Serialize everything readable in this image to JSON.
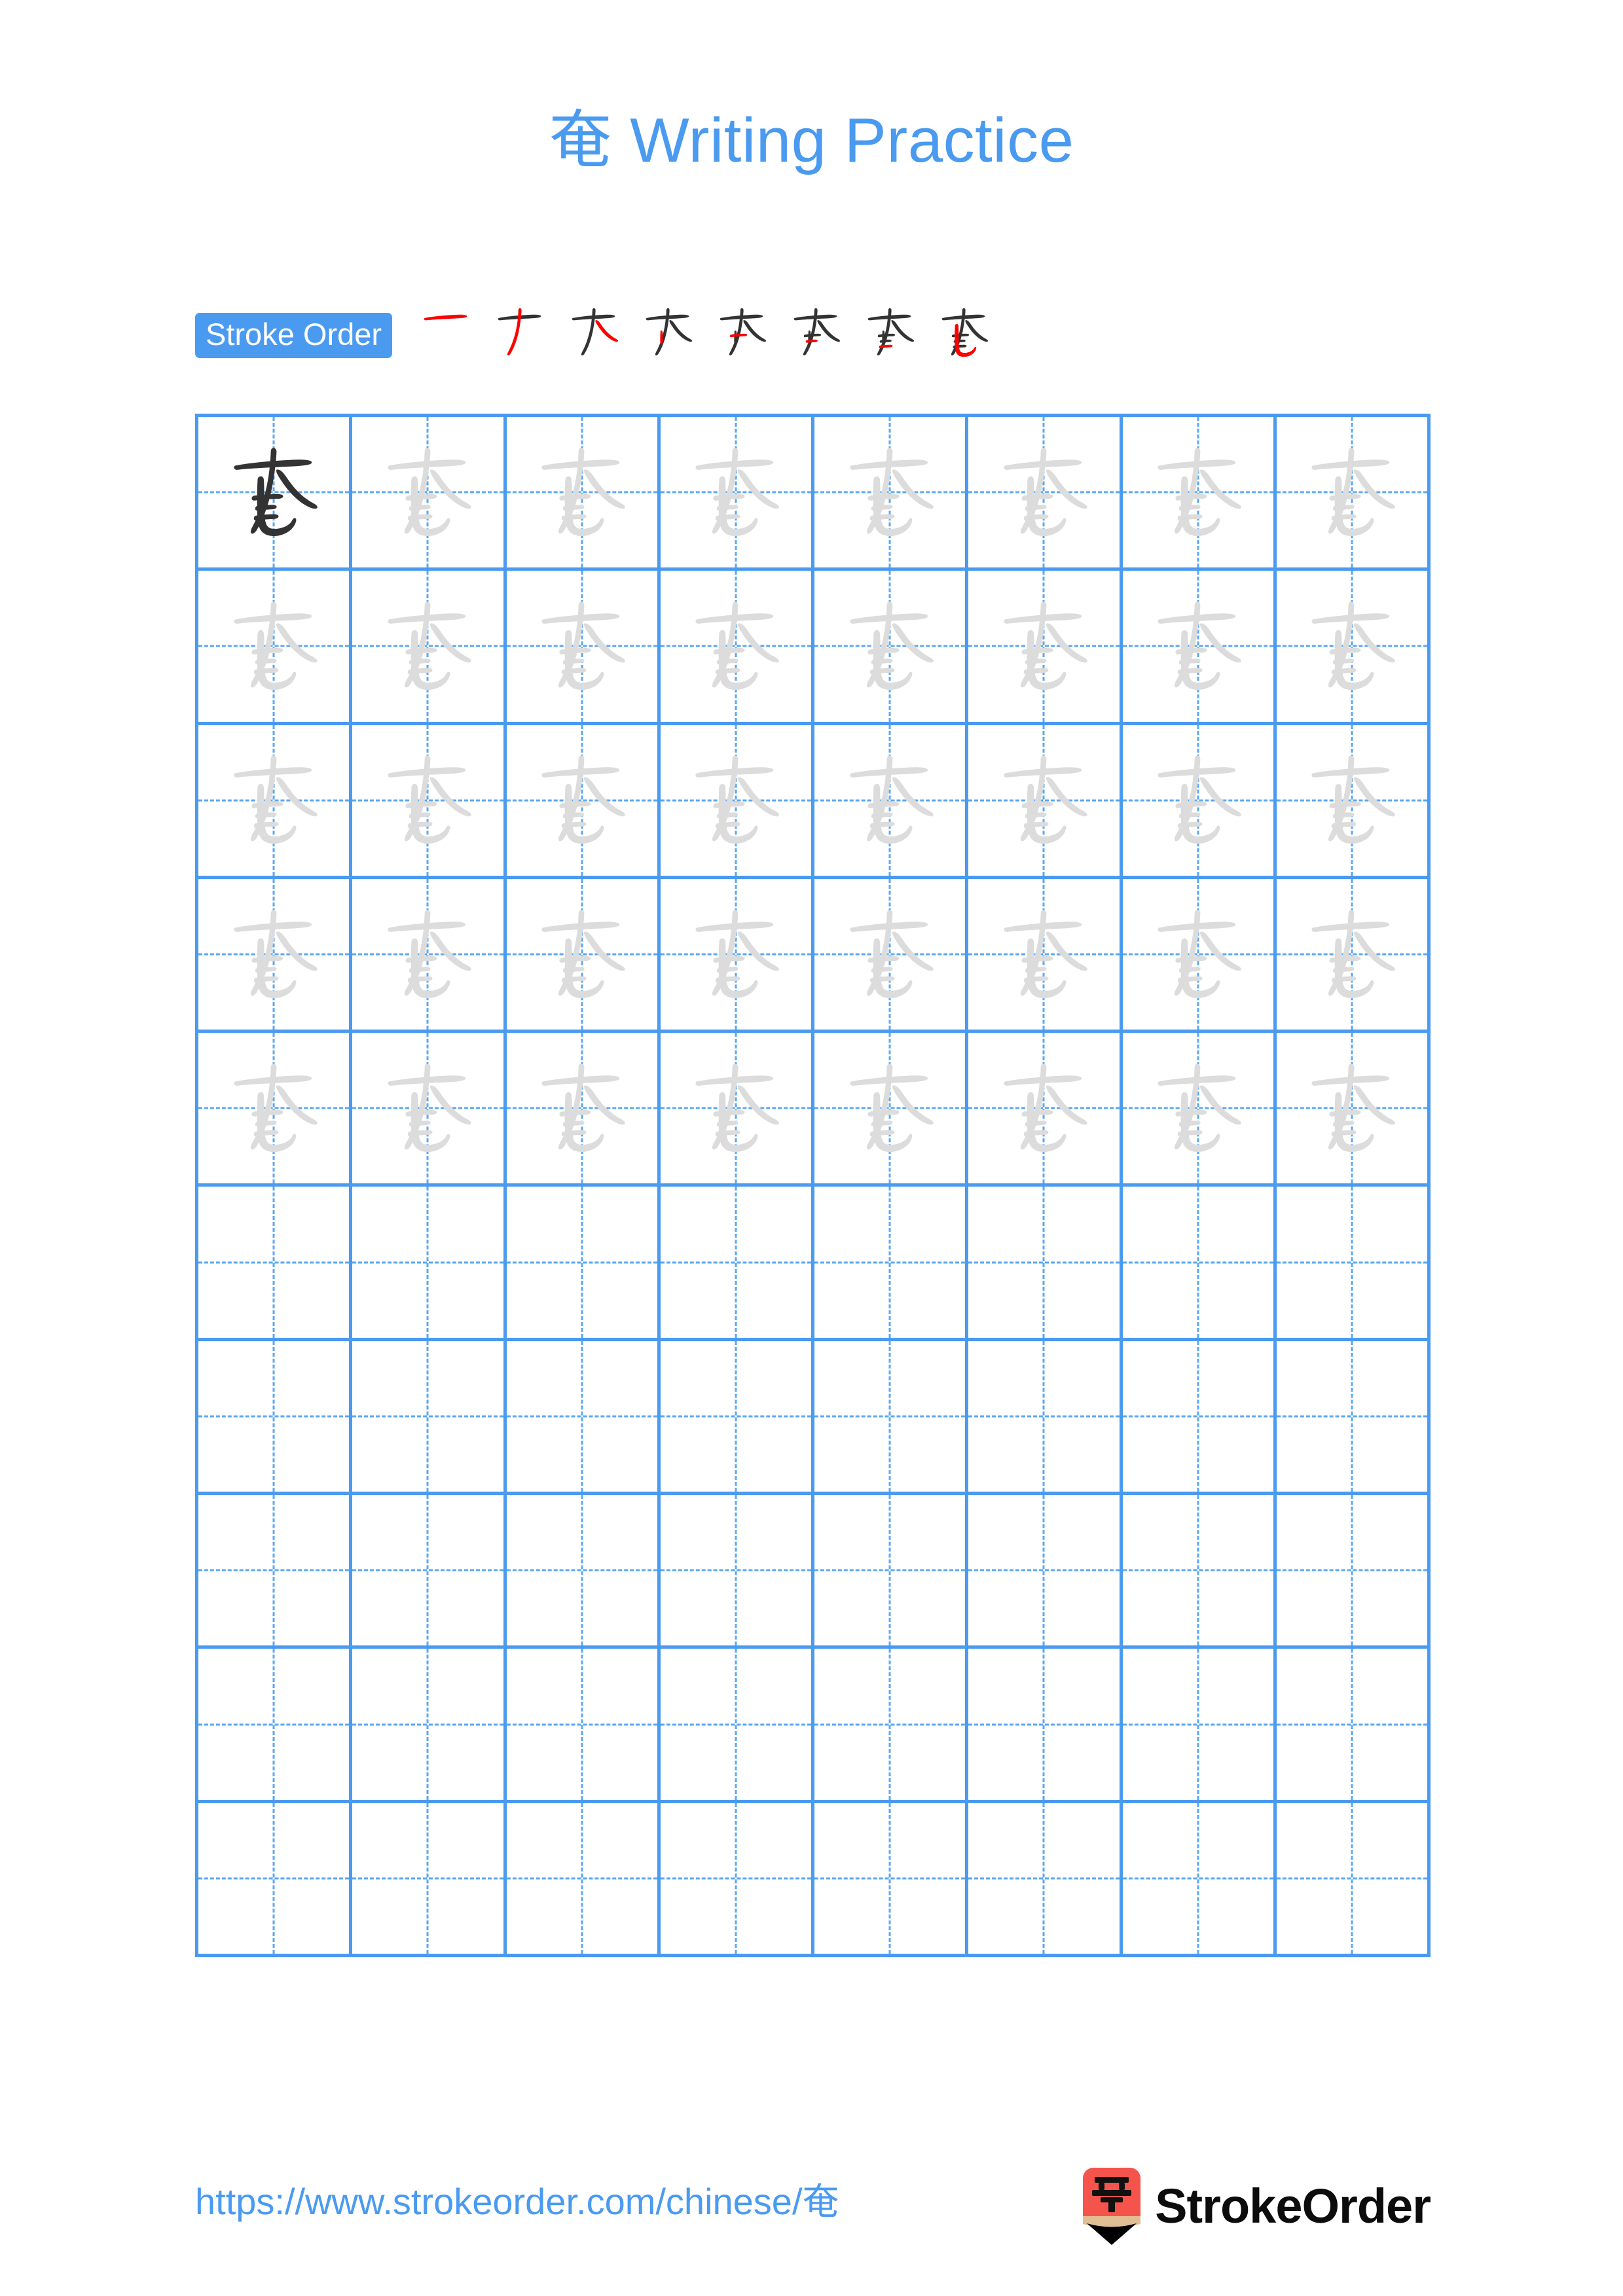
{
  "document": {
    "title": "奄 Writing Practice",
    "character": "奄",
    "page_background": "#ffffff"
  },
  "colors": {
    "accent_blue": "#4a9af0",
    "grid_line": "#4a9af0",
    "grid_dash": "#5aa7f5",
    "glyph_dark": "#333333",
    "glyph_light": "#dcdcdc",
    "stroke_new": "#ff0000",
    "stroke_done": "#333333",
    "logo_red": "#f4544c",
    "logo_wood": "#e0bd93",
    "logo_tip": "#000000"
  },
  "stroke_order": {
    "badge_label": "Stroke Order",
    "total_strokes": 8,
    "steps": [
      {
        "index": 1,
        "strokes_shown": 1,
        "new_stroke": 1
      },
      {
        "index": 2,
        "strokes_shown": 2,
        "new_stroke": 2
      },
      {
        "index": 3,
        "strokes_shown": 3,
        "new_stroke": 3
      },
      {
        "index": 4,
        "strokes_shown": 4,
        "new_stroke": 4
      },
      {
        "index": 5,
        "strokes_shown": 5,
        "new_stroke": 5
      },
      {
        "index": 6,
        "strokes_shown": 6,
        "new_stroke": 6
      },
      {
        "index": 7,
        "strokes_shown": 7,
        "new_stroke": 7
      },
      {
        "index": 8,
        "strokes_shown": 8,
        "new_stroke": 8
      }
    ]
  },
  "practice_grid": {
    "columns": 8,
    "rows": 10,
    "rows_data": [
      [
        "dark",
        "light",
        "light",
        "light",
        "light",
        "light",
        "light",
        "light"
      ],
      [
        "light",
        "light",
        "light",
        "light",
        "light",
        "light",
        "light",
        "light"
      ],
      [
        "light",
        "light",
        "light",
        "light",
        "light",
        "light",
        "light",
        "light"
      ],
      [
        "light",
        "light",
        "light",
        "light",
        "light",
        "light",
        "light",
        "light"
      ],
      [
        "light",
        "light",
        "light",
        "light",
        "light",
        "light",
        "light",
        "light"
      ],
      [
        "empty",
        "empty",
        "empty",
        "empty",
        "empty",
        "empty",
        "empty",
        "empty"
      ],
      [
        "empty",
        "empty",
        "empty",
        "empty",
        "empty",
        "empty",
        "empty",
        "empty"
      ],
      [
        "empty",
        "empty",
        "empty",
        "empty",
        "empty",
        "empty",
        "empty",
        "empty"
      ],
      [
        "empty",
        "empty",
        "empty",
        "empty",
        "empty",
        "empty",
        "empty",
        "empty"
      ],
      [
        "empty",
        "empty",
        "empty",
        "empty",
        "empty",
        "empty",
        "empty",
        "empty"
      ]
    ]
  },
  "footer": {
    "url": "https://www.strokeorder.com/chinese/奄",
    "brand_name": "StrokeOrder",
    "brand_icon_character": "字"
  }
}
